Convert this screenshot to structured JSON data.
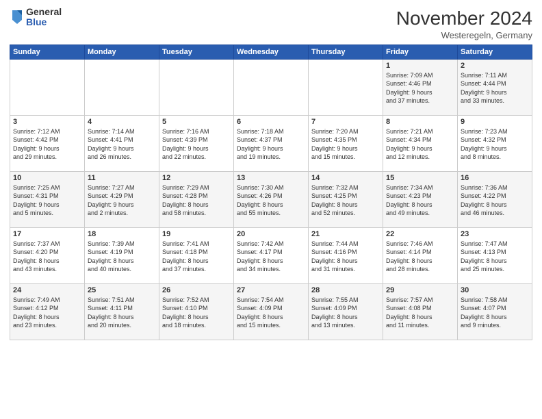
{
  "logo": {
    "general": "General",
    "blue": "Blue"
  },
  "header": {
    "month_title": "November 2024",
    "location": "Westeregeln, Germany"
  },
  "days_of_week": [
    "Sunday",
    "Monday",
    "Tuesday",
    "Wednesday",
    "Thursday",
    "Friday",
    "Saturday"
  ],
  "weeks": [
    [
      {
        "day": "",
        "info": ""
      },
      {
        "day": "",
        "info": ""
      },
      {
        "day": "",
        "info": ""
      },
      {
        "day": "",
        "info": ""
      },
      {
        "day": "",
        "info": ""
      },
      {
        "day": "1",
        "info": "Sunrise: 7:09 AM\nSunset: 4:46 PM\nDaylight: 9 hours\nand 37 minutes."
      },
      {
        "day": "2",
        "info": "Sunrise: 7:11 AM\nSunset: 4:44 PM\nDaylight: 9 hours\nand 33 minutes."
      }
    ],
    [
      {
        "day": "3",
        "info": "Sunrise: 7:12 AM\nSunset: 4:42 PM\nDaylight: 9 hours\nand 29 minutes."
      },
      {
        "day": "4",
        "info": "Sunrise: 7:14 AM\nSunset: 4:41 PM\nDaylight: 9 hours\nand 26 minutes."
      },
      {
        "day": "5",
        "info": "Sunrise: 7:16 AM\nSunset: 4:39 PM\nDaylight: 9 hours\nand 22 minutes."
      },
      {
        "day": "6",
        "info": "Sunrise: 7:18 AM\nSunset: 4:37 PM\nDaylight: 9 hours\nand 19 minutes."
      },
      {
        "day": "7",
        "info": "Sunrise: 7:20 AM\nSunset: 4:35 PM\nDaylight: 9 hours\nand 15 minutes."
      },
      {
        "day": "8",
        "info": "Sunrise: 7:21 AM\nSunset: 4:34 PM\nDaylight: 9 hours\nand 12 minutes."
      },
      {
        "day": "9",
        "info": "Sunrise: 7:23 AM\nSunset: 4:32 PM\nDaylight: 9 hours\nand 8 minutes."
      }
    ],
    [
      {
        "day": "10",
        "info": "Sunrise: 7:25 AM\nSunset: 4:31 PM\nDaylight: 9 hours\nand 5 minutes."
      },
      {
        "day": "11",
        "info": "Sunrise: 7:27 AM\nSunset: 4:29 PM\nDaylight: 9 hours\nand 2 minutes."
      },
      {
        "day": "12",
        "info": "Sunrise: 7:29 AM\nSunset: 4:28 PM\nDaylight: 8 hours\nand 58 minutes."
      },
      {
        "day": "13",
        "info": "Sunrise: 7:30 AM\nSunset: 4:26 PM\nDaylight: 8 hours\nand 55 minutes."
      },
      {
        "day": "14",
        "info": "Sunrise: 7:32 AM\nSunset: 4:25 PM\nDaylight: 8 hours\nand 52 minutes."
      },
      {
        "day": "15",
        "info": "Sunrise: 7:34 AM\nSunset: 4:23 PM\nDaylight: 8 hours\nand 49 minutes."
      },
      {
        "day": "16",
        "info": "Sunrise: 7:36 AM\nSunset: 4:22 PM\nDaylight: 8 hours\nand 46 minutes."
      }
    ],
    [
      {
        "day": "17",
        "info": "Sunrise: 7:37 AM\nSunset: 4:20 PM\nDaylight: 8 hours\nand 43 minutes."
      },
      {
        "day": "18",
        "info": "Sunrise: 7:39 AM\nSunset: 4:19 PM\nDaylight: 8 hours\nand 40 minutes."
      },
      {
        "day": "19",
        "info": "Sunrise: 7:41 AM\nSunset: 4:18 PM\nDaylight: 8 hours\nand 37 minutes."
      },
      {
        "day": "20",
        "info": "Sunrise: 7:42 AM\nSunset: 4:17 PM\nDaylight: 8 hours\nand 34 minutes."
      },
      {
        "day": "21",
        "info": "Sunrise: 7:44 AM\nSunset: 4:16 PM\nDaylight: 8 hours\nand 31 minutes."
      },
      {
        "day": "22",
        "info": "Sunrise: 7:46 AM\nSunset: 4:14 PM\nDaylight: 8 hours\nand 28 minutes."
      },
      {
        "day": "23",
        "info": "Sunrise: 7:47 AM\nSunset: 4:13 PM\nDaylight: 8 hours\nand 25 minutes."
      }
    ],
    [
      {
        "day": "24",
        "info": "Sunrise: 7:49 AM\nSunset: 4:12 PM\nDaylight: 8 hours\nand 23 minutes."
      },
      {
        "day": "25",
        "info": "Sunrise: 7:51 AM\nSunset: 4:11 PM\nDaylight: 8 hours\nand 20 minutes."
      },
      {
        "day": "26",
        "info": "Sunrise: 7:52 AM\nSunset: 4:10 PM\nDaylight: 8 hours\nand 18 minutes."
      },
      {
        "day": "27",
        "info": "Sunrise: 7:54 AM\nSunset: 4:09 PM\nDaylight: 8 hours\nand 15 minutes."
      },
      {
        "day": "28",
        "info": "Sunrise: 7:55 AM\nSunset: 4:09 PM\nDaylight: 8 hours\nand 13 minutes."
      },
      {
        "day": "29",
        "info": "Sunrise: 7:57 AM\nSunset: 4:08 PM\nDaylight: 8 hours\nand 11 minutes."
      },
      {
        "day": "30",
        "info": "Sunrise: 7:58 AM\nSunset: 4:07 PM\nDaylight: 8 hours\nand 9 minutes."
      }
    ]
  ]
}
